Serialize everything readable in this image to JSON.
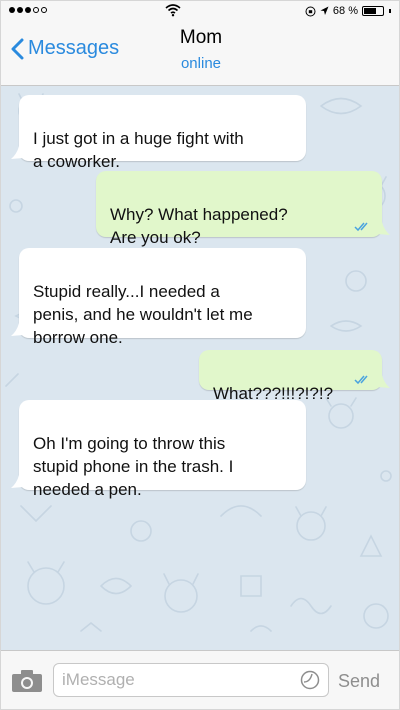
{
  "status_bar": {
    "battery_percent_label": "68 %",
    "battery_level": 0.68,
    "signal_dots_filled": 3,
    "signal_dots_total": 5
  },
  "header": {
    "back_label": "Messages",
    "contact_name": "Mom",
    "contact_status": "online"
  },
  "messages": [
    {
      "direction": "in",
      "text": "I just got in a huge fight with\na coworker."
    },
    {
      "direction": "out",
      "text": "Why? What happened?\nAre you ok?"
    },
    {
      "direction": "in",
      "text": "Stupid really...I needed a\npenis, and he wouldn't let me\nborrow one."
    },
    {
      "direction": "out",
      "text": "What???!!!?!?!?"
    },
    {
      "direction": "in",
      "text": "Oh I'm going to throw this\nstupid phone in the trash. I\nneeded a pen."
    }
  ],
  "input_bar": {
    "placeholder": "iMessage",
    "send_label": "Send"
  },
  "colors": {
    "accent": "#2a8ade",
    "outgoing_bubble": "#e1f7cb",
    "incoming_bubble": "#ffffff",
    "chat_background": "#dbe6ef"
  }
}
